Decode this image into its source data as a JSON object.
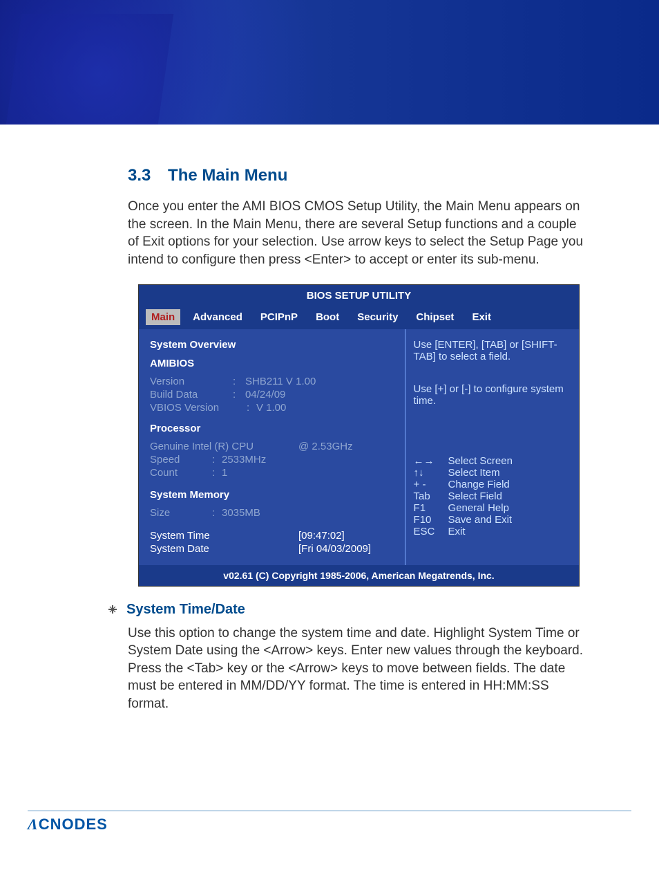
{
  "section": {
    "number": "3.3",
    "title": "The Main Menu",
    "intro": "Once you enter the AMI BIOS CMOS Setup Utility, the Main Menu appears on the screen. In the Main Menu, there are several Setup functions and a couple of Exit options for your selection. Use arrow keys to select the Setup Page you intend to configure then press <Enter> to accept or enter its sub-menu."
  },
  "bios": {
    "title": "BIOS SETUP UTILITY",
    "tabs": [
      "Main",
      "Advanced",
      "PCIPnP",
      "Boot",
      "Security",
      "Chipset",
      "Exit"
    ],
    "left": {
      "system_overview": "System Overview",
      "amibios_label": "AMIBIOS",
      "version_label": "Version",
      "version_value": "SHB211 V 1.00",
      "build_data_label": "Build Data",
      "build_data_value": "04/24/09",
      "vbios_label": "VBIOS  Version",
      "vbios_value": "V 1.00",
      "processor_label": "Processor",
      "cpu_name": "Genuine Intel (R) CPU",
      "cpu_freq": "@ 2.53GHz",
      "speed_label": "Speed",
      "speed_value": "2533MHz",
      "count_label": "Count",
      "count_value": "1",
      "memory_label": "System Memory",
      "size_label": "Size",
      "size_value": "3035MB",
      "system_time_label": "System Time",
      "system_time_value": "[09:47:02]",
      "system_date_label": "System Date",
      "system_date_value": "[Fri 04/03/2009]"
    },
    "right": {
      "help1": "Use [ENTER], [TAB] or [SHIFT-TAB] to select a field.",
      "help2": "Use [+] or [-] to configure system time.",
      "nav": [
        {
          "key": "←→",
          "label": "Select Screen"
        },
        {
          "key": "↑↓",
          "label": "Select Item"
        },
        {
          "key": "+ -",
          "label": "Change Field"
        },
        {
          "key": "Tab",
          "label": "Select Field"
        },
        {
          "key": "F1",
          "label": "General Help"
        },
        {
          "key": "F10",
          "label": "Save and Exit"
        },
        {
          "key": "ESC",
          "label": "Exit"
        }
      ]
    },
    "footer": "v02.61 (C) Copyright 1985-2006, American Megatrends, Inc."
  },
  "sub_section": {
    "heading": "System Time/Date",
    "body": "Use this option to change the system time and date. Highlight System Time or System Date using the <Arrow> keys. Enter new values through the keyboard. Press the <Tab> key or the <Arrow> keys to move between fields. The date must be entered in MM/DD/YY format. The time is entered in HH:MM:SS format."
  },
  "brand": "CNODES"
}
